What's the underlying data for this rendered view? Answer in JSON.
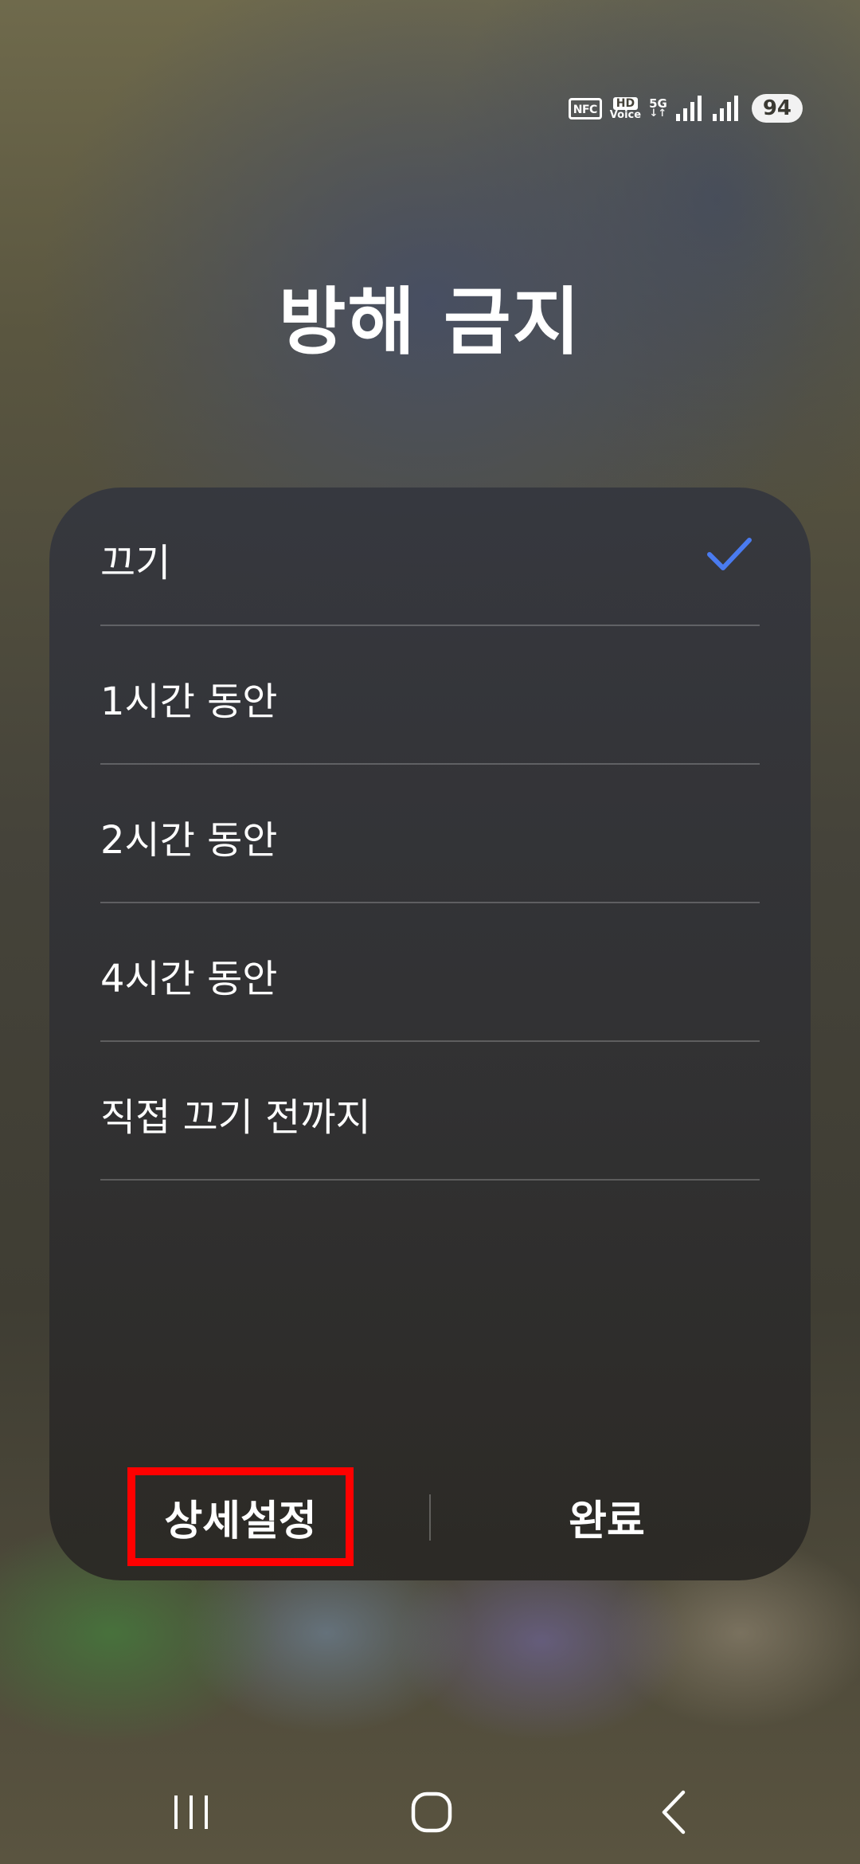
{
  "status_bar": {
    "nfc": "NFC",
    "hd_top": "HD",
    "hd_bottom": "Voice",
    "network": "5G",
    "network_arrows": "↓↑",
    "battery": "94"
  },
  "dialog": {
    "title": "방해 금지",
    "options": [
      {
        "label": "끄기",
        "selected": true
      },
      {
        "label": "1시간 동안",
        "selected": false
      },
      {
        "label": "2시간 동안",
        "selected": false
      },
      {
        "label": "4시간 동안",
        "selected": false
      },
      {
        "label": "직접 끄기 전까지",
        "selected": false
      }
    ],
    "detail_button": "상세설정",
    "done_button": "완료"
  },
  "colors": {
    "check_accent": "#4a7bf0",
    "highlight": "#ff0000"
  },
  "icons": {
    "check": "checkmark-icon",
    "recents": "recent-apps-icon",
    "home": "home-icon",
    "back": "back-icon"
  }
}
